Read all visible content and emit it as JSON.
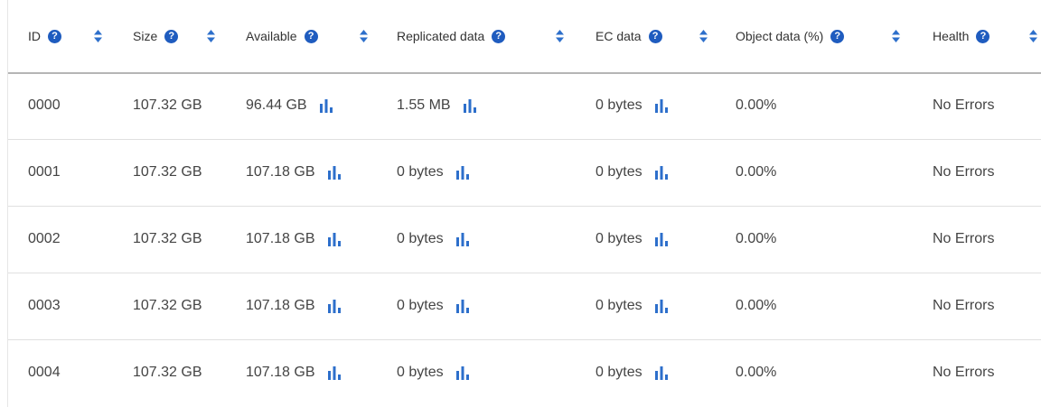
{
  "table": {
    "columns": [
      {
        "key": "id",
        "label": "ID",
        "help_icon": "question-circle-icon",
        "sort_icon": "sort-icon"
      },
      {
        "key": "size",
        "label": "Size",
        "help_icon": "question-circle-icon",
        "sort_icon": "sort-icon"
      },
      {
        "key": "available",
        "label": "Available",
        "help_icon": "question-circle-icon",
        "sort_icon": "sort-icon"
      },
      {
        "key": "replicated",
        "label": "Replicated data",
        "help_icon": "question-circle-icon",
        "sort_icon": "sort-icon"
      },
      {
        "key": "ec",
        "label": "EC data",
        "help_icon": "question-circle-icon",
        "sort_icon": "sort-icon"
      },
      {
        "key": "object",
        "label": "Object data (%)",
        "help_icon": "question-circle-icon",
        "sort_icon": "sort-icon"
      },
      {
        "key": "health",
        "label": "Health",
        "help_icon": "question-circle-icon",
        "sort_icon": "sort-icon"
      }
    ],
    "rows": [
      {
        "id": "0000",
        "size": "107.32 GB",
        "available": "96.44 GB",
        "replicated": "1.55 MB",
        "ec": "0 bytes",
        "object": "0.00%",
        "health": "No Errors"
      },
      {
        "id": "0001",
        "size": "107.32 GB",
        "available": "107.18 GB",
        "replicated": "0 bytes",
        "ec": "0 bytes",
        "object": "0.00%",
        "health": "No Errors"
      },
      {
        "id": "0002",
        "size": "107.32 GB",
        "available": "107.18 GB",
        "replicated": "0 bytes",
        "ec": "0 bytes",
        "object": "0.00%",
        "health": "No Errors"
      },
      {
        "id": "0003",
        "size": "107.32 GB",
        "available": "107.18 GB",
        "replicated": "0 bytes",
        "ec": "0 bytes",
        "object": "0.00%",
        "health": "No Errors"
      },
      {
        "id": "0004",
        "size": "107.32 GB",
        "available": "107.18 GB",
        "replicated": "0 bytes",
        "ec": "0 bytes",
        "object": "0.00%",
        "health": "No Errors"
      }
    ],
    "chart_icon": "bar-chart-icon"
  },
  "colors": {
    "accent": "#1f5cbf",
    "chart_icon": "#2d6fcb",
    "sort_icon": "#2d6fcb"
  }
}
